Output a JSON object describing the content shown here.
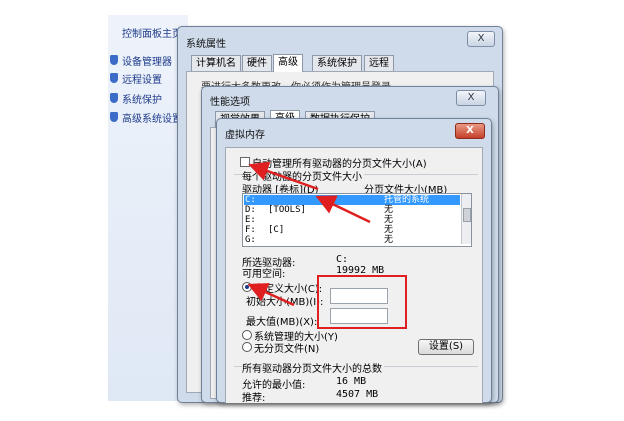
{
  "control_panel": {
    "home_link": "控制面板主页",
    "links": [
      "设备管理器",
      "远程设置",
      "系统保护",
      "高级系统设置"
    ]
  },
  "system_properties": {
    "title": "系统属性",
    "close_label": "X",
    "tabs": [
      "计算机名",
      "硬件",
      "高级",
      "系统保护",
      "远程"
    ],
    "active_tab": "高级",
    "partial_text": "要进行大多数更改，你必须作为管理员登录。"
  },
  "performance_options": {
    "title": "性能选项",
    "close_label": "X",
    "tabs": [
      "视觉效果",
      "高级",
      "数据执行保护"
    ]
  },
  "virtual_memory": {
    "title": "虚拟内存",
    "close_label": "X",
    "auto_manage_label": "自动管理所有驱动器的分页文件大小(A)",
    "group_label": "每个驱动器的分页文件大小",
    "col_drive": "驱动器 [卷标](D)",
    "col_size": "分页文件大小(MB)",
    "drives": [
      {
        "drive": "C:",
        "label": "",
        "size": "托管的系统",
        "selected": true
      },
      {
        "drive": "D:",
        "label": "[TOOLS]",
        "size": "无",
        "selected": false
      },
      {
        "drive": "E:",
        "label": "",
        "size": "无",
        "selected": false
      },
      {
        "drive": "F:",
        "label": "[C]",
        "size": "无",
        "selected": false
      },
      {
        "drive": "G:",
        "label": "",
        "size": "无",
        "selected": false
      }
    ],
    "selected_drive_label": "所选驱动器:",
    "selected_drive_value": "C:",
    "free_space_label": "可用空间:",
    "free_space_value": "19992 MB",
    "custom_size_label": "自定义大小(C):",
    "initial_size_label": "初始大小(MB)(I):",
    "initial_size_value": "",
    "max_size_label": "最大值(MB)(X):",
    "max_size_value": "",
    "system_managed_label": "系统管理的大小(Y)",
    "no_paging_label": "无分页文件(N)",
    "set_button": "设置(S)",
    "total_group_label": "所有驱动器分页文件大小的总数",
    "min_allowed_label": "允许的最小值:",
    "min_allowed_value": "16 MB",
    "recommended_label": "推荐:",
    "recommended_value": "4507 MB"
  },
  "colors": {
    "annotation_red": "#e02020",
    "selection_blue": "#3399ff",
    "link_blue": "#1e3b8a"
  }
}
